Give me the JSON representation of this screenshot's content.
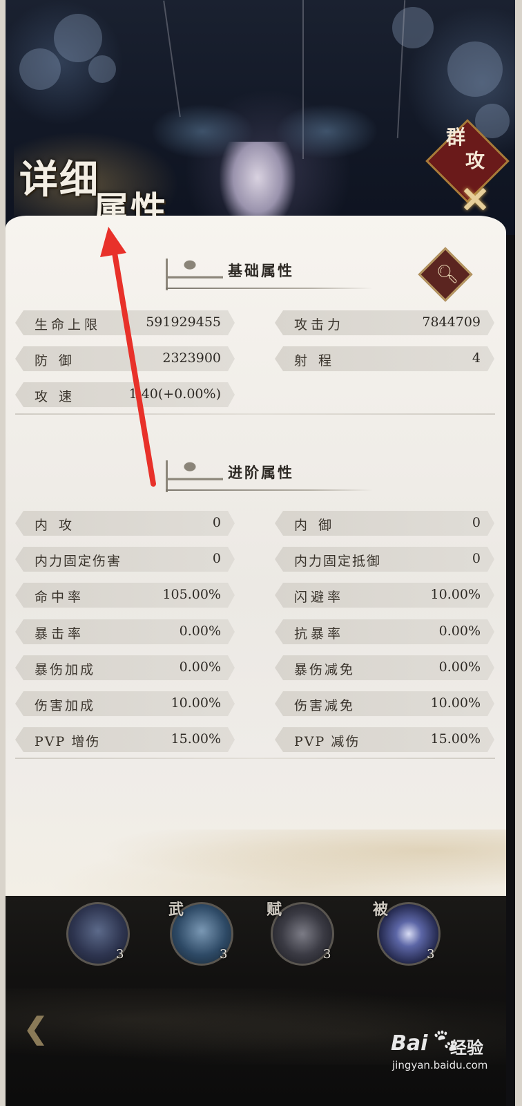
{
  "header": {
    "title_line1": "详细",
    "title_line2": "属性",
    "stamp_line1": "群",
    "stamp_line2": "攻",
    "stamp_icon": "crossed-swords-icon"
  },
  "basic": {
    "title": "基础属性",
    "search_icon": "magnifier-icon",
    "stats": [
      {
        "label": "生命上限",
        "value": "591929455"
      },
      {
        "label": "攻击力",
        "value": "7844709"
      },
      {
        "label": "防 御",
        "value": "2323900"
      },
      {
        "label": "射 程",
        "value": "4"
      },
      {
        "label": "攻 速",
        "value": "1.40(+0.00%)"
      }
    ]
  },
  "advanced": {
    "title": "进阶属性",
    "stats": [
      {
        "label": "内 攻",
        "value": "0"
      },
      {
        "label": "内 御",
        "value": "0"
      },
      {
        "label": "内力固定伤害",
        "value": "0"
      },
      {
        "label": "内力固定抵御",
        "value": "0"
      },
      {
        "label": "命中率",
        "value": "105.00%"
      },
      {
        "label": "闪避率",
        "value": "10.00%"
      },
      {
        "label": "暴击率",
        "value": "0.00%"
      },
      {
        "label": "抗暴率",
        "value": "0.00%"
      },
      {
        "label": "暴伤加成",
        "value": "0.00%"
      },
      {
        "label": "暴伤减免",
        "value": "0.00%"
      },
      {
        "label": "伤害加成",
        "value": "10.00%"
      },
      {
        "label": "伤害减免",
        "value": "10.00%"
      },
      {
        "label": "PVP 增伤",
        "value": "15.00%"
      },
      {
        "label": "PVP 减伤",
        "value": "15.00%"
      }
    ]
  },
  "skills": [
    {
      "tag": "",
      "level": "3",
      "icon": "skill-portrait-icon"
    },
    {
      "tag": "武",
      "level": "3",
      "icon": "skill-wave-icon"
    },
    {
      "tag": "赋",
      "level": "3",
      "icon": "skill-web-icon"
    },
    {
      "tag": "被",
      "level": "3",
      "icon": "skill-burst-icon"
    }
  ],
  "nav": {
    "back_icon": "back-arrow-icon"
  },
  "watermark": {
    "brand": "Bai",
    "name": "经验",
    "url": "jingyan.baidu.com",
    "icon": "paw-icon"
  },
  "colors": {
    "accent_red": "#e8312a",
    "panel": "#efece7",
    "stamp_red": "#6a1a1a",
    "gold": "#b49560"
  }
}
